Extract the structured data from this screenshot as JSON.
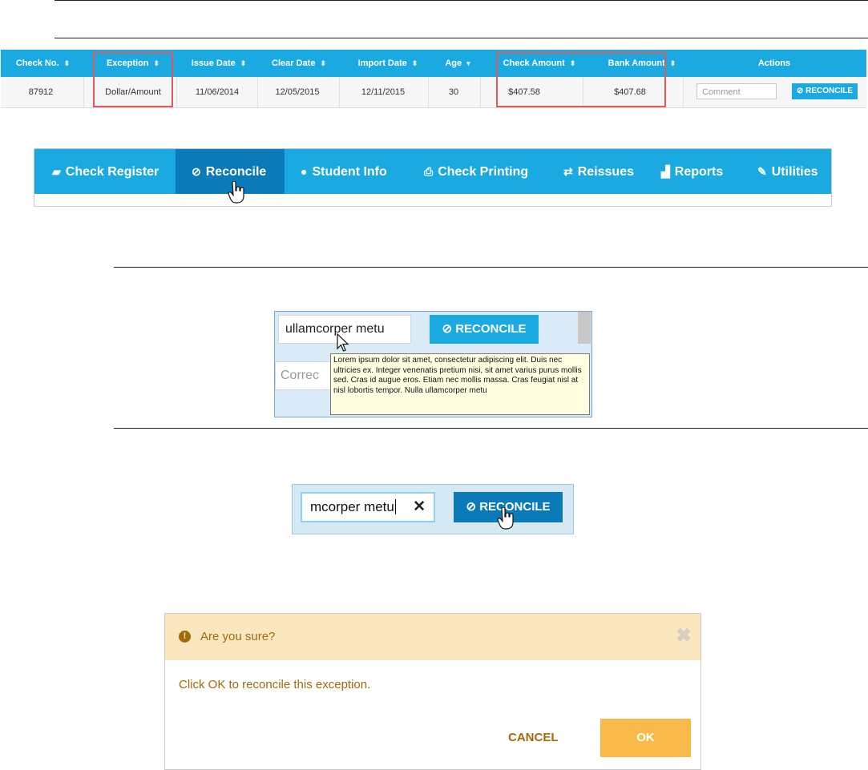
{
  "table": {
    "headers": [
      {
        "label": "Check No.",
        "sort": "⬍"
      },
      {
        "label": "Exception",
        "sort": "⬍"
      },
      {
        "label": "Issue Date",
        "sort": "⬍"
      },
      {
        "label": "Clear Date",
        "sort": "⬍"
      },
      {
        "label": "Import Date",
        "sort": "⬍"
      },
      {
        "label": "Age",
        "sort": "▾"
      },
      {
        "label": "Check Amount",
        "sort": "⬍"
      },
      {
        "label": "Bank Amount",
        "sort": "⬍"
      },
      {
        "label": "Actions",
        "sort": ""
      }
    ],
    "row": {
      "check_no": "87912",
      "exception": "Dollar/Amount",
      "issue_date": "11/06/2014",
      "clear_date": "12/05/2015",
      "import_date": "12/11/2015",
      "age": "30",
      "check_amount": "$407.58",
      "bank_amount": "$407.68",
      "comment_placeholder": "Comment",
      "reconcile_label": "RECONCILE"
    },
    "icons": {
      "reconcile": "check-circle-icon"
    }
  },
  "nav": {
    "items": [
      {
        "label": "Check Register",
        "icon": "book-icon",
        "glyph": "▰"
      },
      {
        "label": "Reconcile",
        "icon": "check-circle-icon",
        "glyph": "⊘",
        "active": true
      },
      {
        "label": "Student Info",
        "icon": "user-icon",
        "glyph": "●"
      },
      {
        "label": "Check Printing",
        "icon": "printer-icon",
        "glyph": "⎙"
      },
      {
        "label": "Reissues",
        "icon": "retweet-icon",
        "glyph": "⇄"
      },
      {
        "label": "Reports",
        "icon": "area-chart-icon",
        "glyph": "▟"
      },
      {
        "label": "Utilities",
        "icon": "wrench-icon",
        "glyph": "✎"
      }
    ]
  },
  "tooltip_demo": {
    "input_value": "ullamcorper metu",
    "reconcile_label": "RECONCILE",
    "second_input_value": "Correc",
    "tooltip_text": "Lorem ipsum dolor sit amet, consectetur adipiscing elit. Duis nec ultricies ex. Integer venenatis pretium nisi, sit amet varius purus mollis sed. Cras id augue eros. Etiam nec mollis massa. Cras feugiat nisl at nisl lobortis tempor. Nulla ullamcorper metu"
  },
  "edit_demo": {
    "input_value": "mcorper metu",
    "clear_glyph": "✕",
    "reconcile_label": "RECONCILE"
  },
  "dialog": {
    "title": "Are you sure?",
    "warn_glyph": "!",
    "close_glyph": "✖",
    "message": "Click OK to reconcile this exception.",
    "cancel_label": "CANCEL",
    "ok_label": "OK"
  },
  "colors": {
    "primary": "#1ba9e1",
    "primary_dark": "#0b7ab8",
    "highlight": "#e05a5a",
    "warning_bg": "#fbe7bf",
    "warning_text": "#a36a07",
    "ok": "#f9b949"
  }
}
